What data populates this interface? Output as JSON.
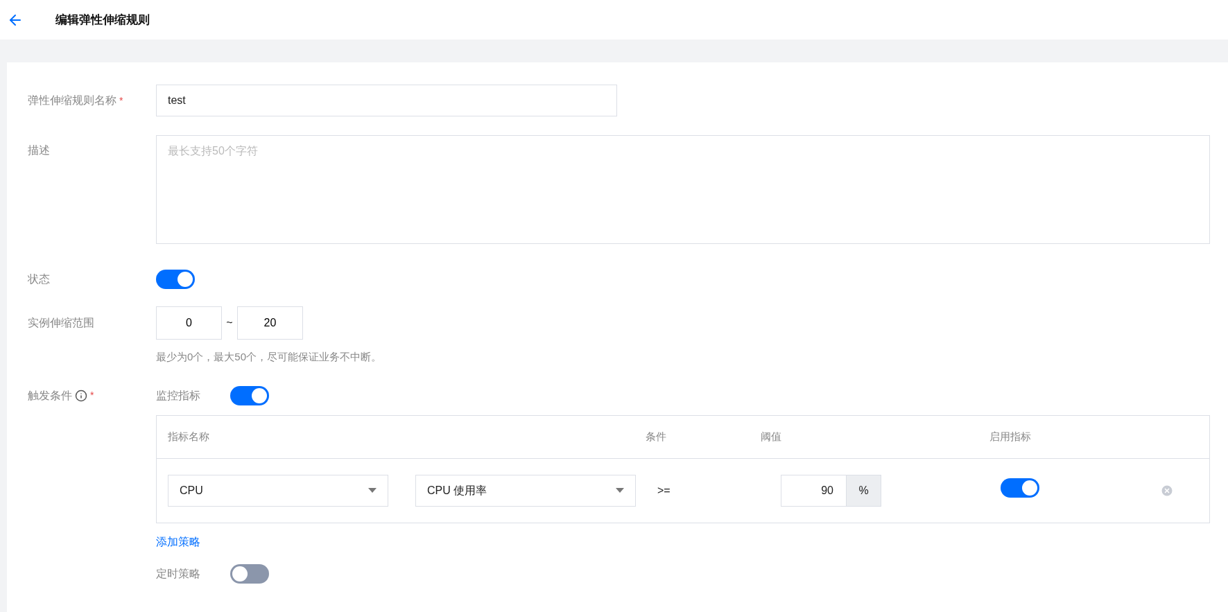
{
  "header": {
    "title": "编辑弹性伸缩规则"
  },
  "form": {
    "name": {
      "label": "弹性伸缩规则名称",
      "required_mark": "*",
      "value": "test"
    },
    "description": {
      "label": "描述",
      "placeholder": "最长支持50个字符"
    },
    "status": {
      "label": "状态",
      "on": true
    },
    "range": {
      "label": "实例伸缩范围",
      "min": "0",
      "separator": "~",
      "max": "20",
      "hint": "最少为0个，最大50个，尽可能保证业务不中断。"
    },
    "trigger": {
      "label": "触发条件",
      "required_mark": "*",
      "metric_policy": {
        "label": "监控指标",
        "on": true
      },
      "table": {
        "columns": [
          "指标名称",
          "条件",
          "阈值",
          "启用指标"
        ],
        "rows": [
          {
            "metric": "CPU",
            "indicator": "CPU 使用率",
            "condition": ">=",
            "threshold": "90",
            "unit": "%",
            "enabled": true
          }
        ]
      },
      "add_link": "添加策略",
      "schedule_policy": {
        "label": "定时策略",
        "on": false
      }
    }
  }
}
